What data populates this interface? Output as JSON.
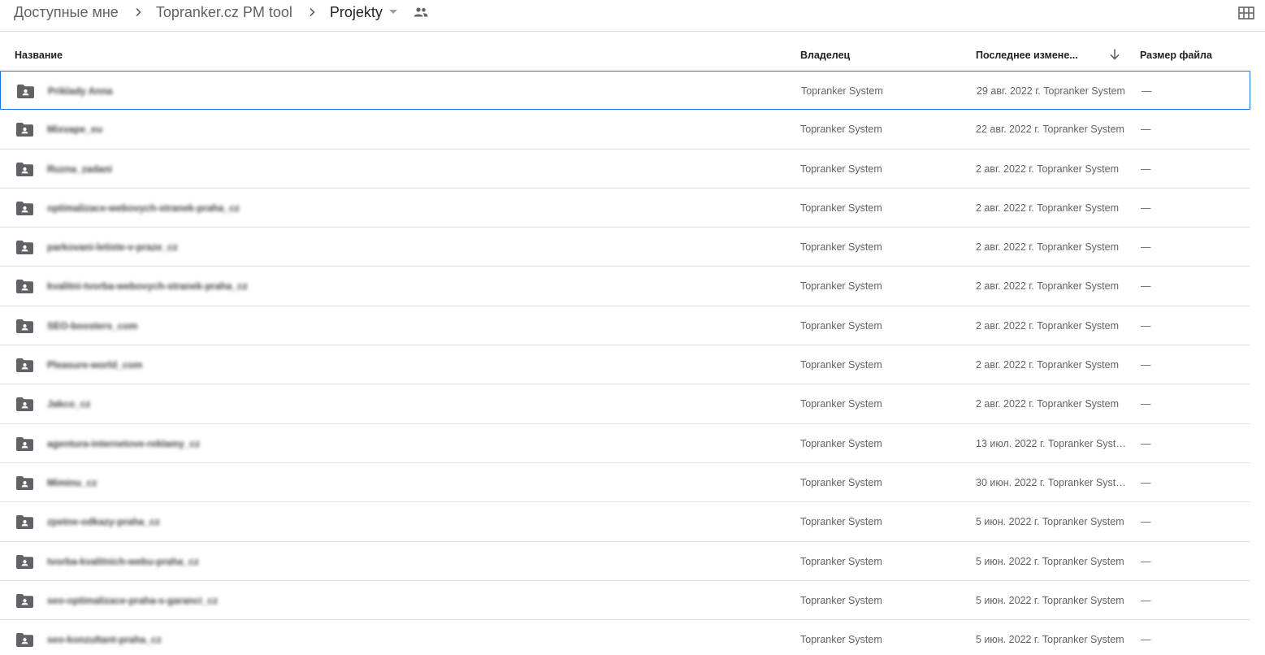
{
  "breadcrumb": {
    "items": [
      "Доступные мне",
      "Topranker.cz PM tool",
      "Projekty"
    ]
  },
  "icons": {
    "separator": "chevron-right-icon",
    "dropdown": "caret-down-icon",
    "shared": "people-icon",
    "layout": "grid-view-icon",
    "folder": "shared-folder-icon",
    "sort": "arrow-down-icon"
  },
  "columns": {
    "name": "Название",
    "owner": "Владелец",
    "modified": "Последнее измене...",
    "size": "Размер файла"
  },
  "files": [
    {
      "name": "Priklady Anna",
      "owner": "Topranker System",
      "modified": "29 авг. 2022 г. Topranker System",
      "size": "—"
    },
    {
      "name": "Mixvape_eu",
      "owner": "Topranker System",
      "modified": "22 авг. 2022 г. Topranker System",
      "size": "—"
    },
    {
      "name": "Ruzna_zadani",
      "owner": "Topranker System",
      "modified": "2 авг. 2022 г. Topranker System",
      "size": "—"
    },
    {
      "name": "optimalizace-webovych-stranek-praha_cz",
      "owner": "Topranker System",
      "modified": "2 авг. 2022 г. Topranker System",
      "size": "—"
    },
    {
      "name": "parkovani-letiste-v-praze_cz",
      "owner": "Topranker System",
      "modified": "2 авг. 2022 г. Topranker System",
      "size": "—"
    },
    {
      "name": "kvalitni-tvorba-webovych-stranek-praha_cz",
      "owner": "Topranker System",
      "modified": "2 авг. 2022 г. Topranker System",
      "size": "—"
    },
    {
      "name": "SEO-boosters_com",
      "owner": "Topranker System",
      "modified": "2 авг. 2022 г. Topranker System",
      "size": "—"
    },
    {
      "name": "Pleasure-world_com",
      "owner": "Topranker System",
      "modified": "2 авг. 2022 г. Topranker System",
      "size": "—"
    },
    {
      "name": "Jakco_cz",
      "owner": "Topranker System",
      "modified": "2 авг. 2022 г. Topranker System",
      "size": "—"
    },
    {
      "name": "agentura-internetove-reklamy_cz",
      "owner": "Topranker System",
      "modified": "13 июл. 2022 г. Topranker System",
      "size": "—"
    },
    {
      "name": "Miminu_cz",
      "owner": "Topranker System",
      "modified": "30 июн. 2022 г. Topranker System",
      "size": "—"
    },
    {
      "name": "zpetne-odkazy-praha_cz",
      "owner": "Topranker System",
      "modified": "5 июн. 2022 г. Topranker System",
      "size": "—"
    },
    {
      "name": "tvorba-kvalitnich-webu-praha_cz",
      "owner": "Topranker System",
      "modified": "5 июн. 2022 г. Topranker System",
      "size": "—"
    },
    {
      "name": "seo-optimalizace-praha-s-garanci_cz",
      "owner": "Topranker System",
      "modified": "5 июн. 2022 г. Topranker System",
      "size": "—"
    },
    {
      "name": "seo-konzultant-praha_cz",
      "owner": "Topranker System",
      "modified": "5 июн. 2022 г. Topranker System",
      "size": "—"
    }
  ],
  "selected_index": 0,
  "colors": {
    "selection_border": "#1a73e8",
    "icon": "#5f6368",
    "divider": "#e0e0e0"
  }
}
